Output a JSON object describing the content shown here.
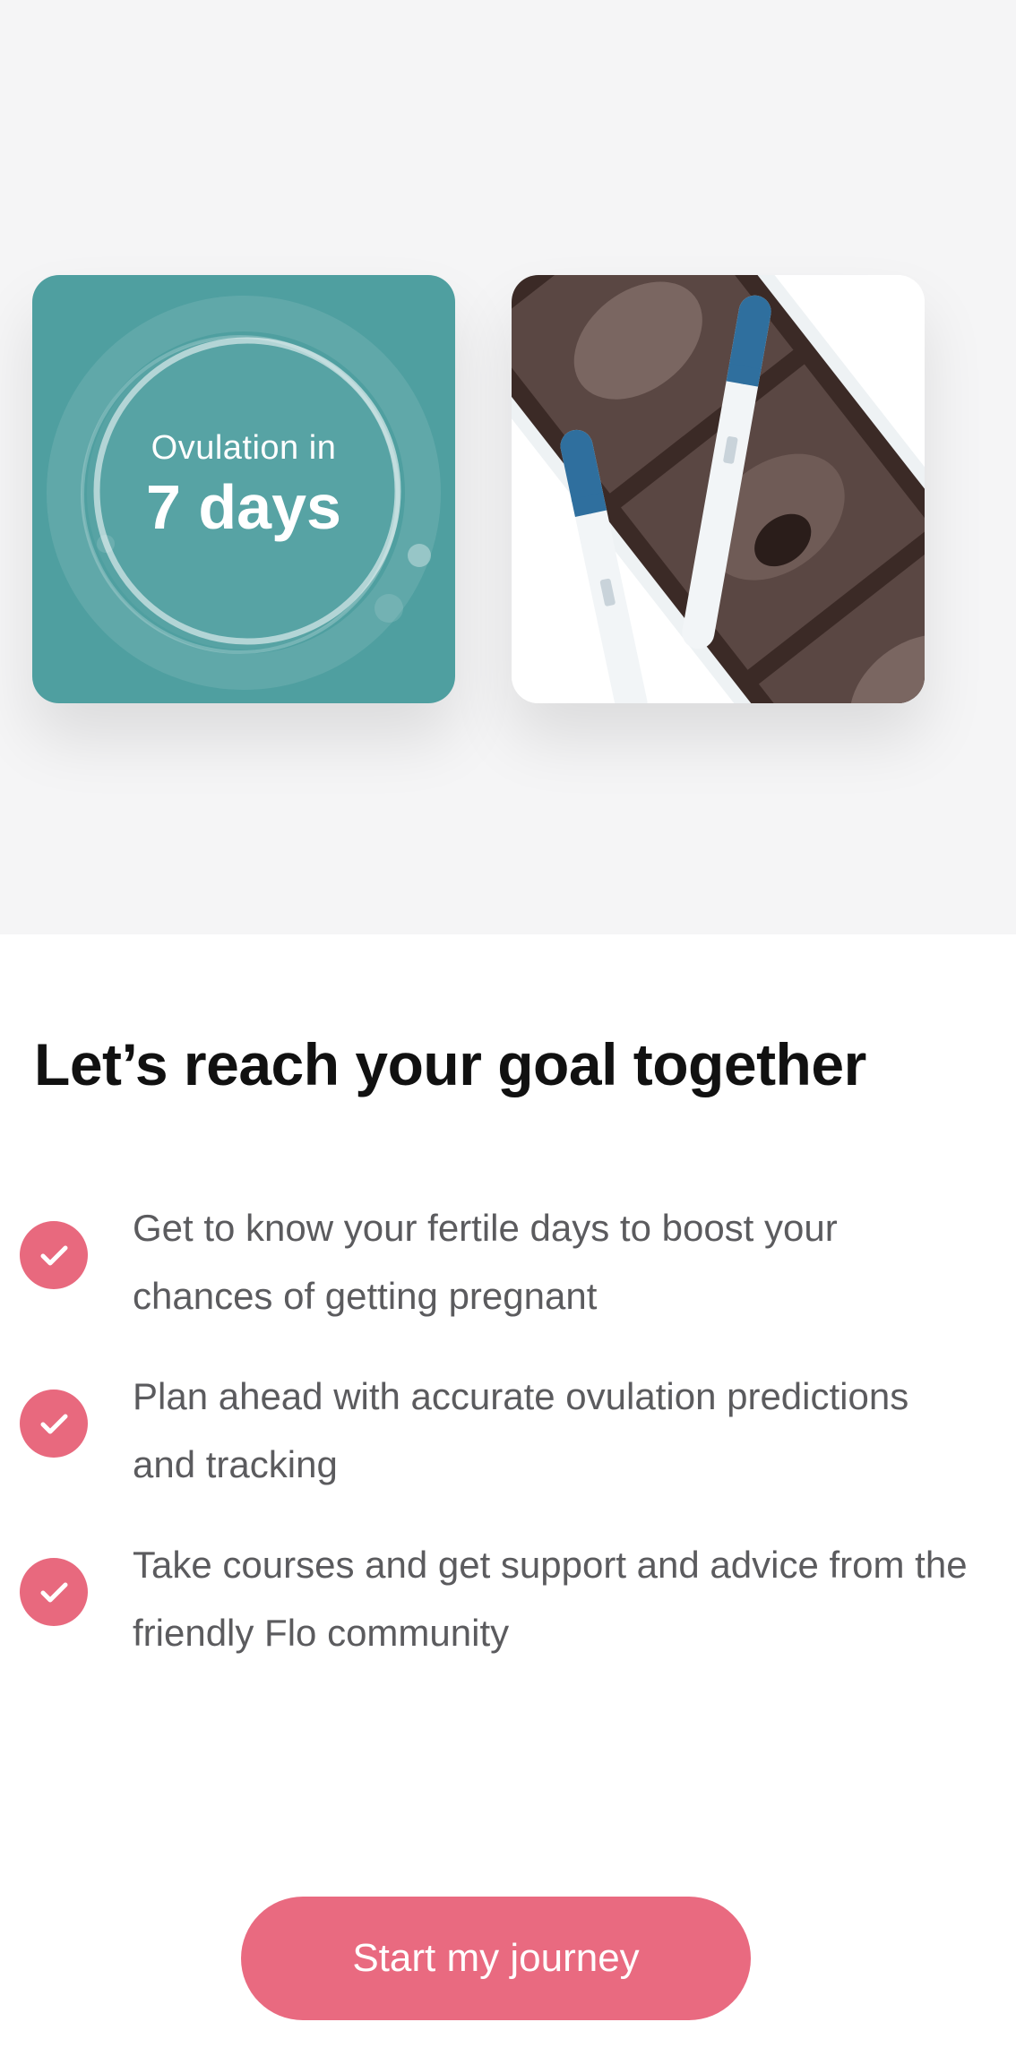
{
  "hero": {
    "ovulation_card": {
      "label": "Ovulation in",
      "value": "7 days",
      "background": "#4f9fa0"
    },
    "photo_card": {
      "image": "ovulation-tests-and-ultrasound-photos"
    }
  },
  "main": {
    "heading": "Let’s reach your goal together",
    "benefits": [
      {
        "icon": "check-icon",
        "text": "Get to know your fertile days to boost your chances of getting pregnant"
      },
      {
        "icon": "check-icon",
        "text": "Plan ahead with accurate ovulation predictions and tracking"
      },
      {
        "icon": "check-icon",
        "text": "Take courses and get support and advice from the friendly Flo community"
      }
    ]
  },
  "cta": {
    "label": "Start my journey",
    "color": "#e96a80"
  },
  "colors": {
    "accent": "#e8697e",
    "teal": "#4f9fa0",
    "hero_background": "#f5f5f6"
  }
}
